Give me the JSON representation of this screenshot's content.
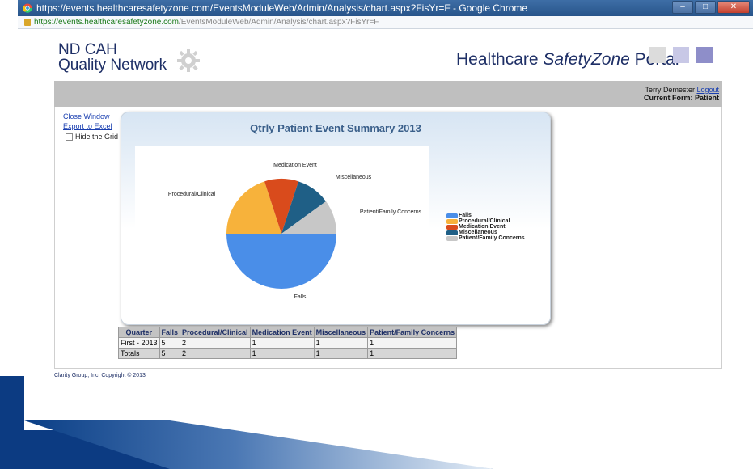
{
  "browser": {
    "window_title": "https://events.healthcaresafetyzone.com/EventsModuleWeb/Admin/Analysis/chart.aspx?FisYr=F - Google Chrome",
    "url_host": "https://events.healthcaresafetyzone.com",
    "url_path": "/EventsModuleWeb/Admin/Analysis/chart.aspx?FisYr=F"
  },
  "header": {
    "logo_line1": "ND CAH",
    "logo_line2": "Quality Network",
    "brand_prefix": "Healthcare ",
    "brand_italic": "SafetyZone",
    "brand_suffix": " Portal",
    "square_colors": [
      "#dcdcdc",
      "#c8c8e6",
      "#8e8ec9"
    ]
  },
  "user": {
    "name": "Terry Demester",
    "logout_label": "Logout",
    "current_form_label": "Current Form: Patient"
  },
  "sidebar": {
    "close_window": "Close Window",
    "export_excel": "Export to Excel",
    "hide_grid_label": "Hide the Grid"
  },
  "chart_data": {
    "type": "pie",
    "title": "Qtrly Patient Event Summary 2013",
    "categories": [
      "Falls",
      "Procedural/Clinical",
      "Medication Event",
      "Miscellaneous",
      "Patient/Family Concerns"
    ],
    "values": [
      5,
      2,
      1,
      1,
      1
    ],
    "colors": [
      "#4a8ee8",
      "#f7b23b",
      "#d94b1c",
      "#1f5f86",
      "#c7c7c7"
    ],
    "legend_position": "right"
  },
  "table": {
    "headers": [
      "Quarter",
      "Falls",
      "Procedural/Clinical",
      "Medication Event",
      "Miscellaneous",
      "Patient/Family Concerns"
    ],
    "rows": [
      [
        "First - 2013",
        "5",
        "2",
        "1",
        "1",
        "1"
      ],
      [
        "Totals",
        "5",
        "2",
        "1",
        "1",
        "1"
      ]
    ]
  },
  "footer": {
    "copyright": "Clarity Group, Inc. Copyright © 2013"
  }
}
